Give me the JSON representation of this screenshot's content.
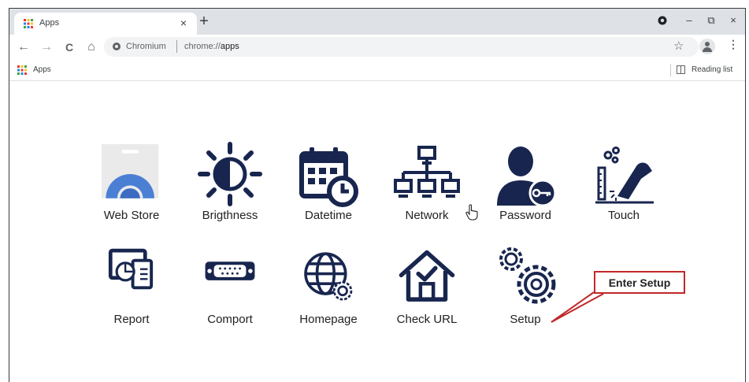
{
  "browser": {
    "tab": {
      "title": "Apps",
      "close_glyph": "×"
    },
    "new_tab_glyph": "+",
    "window_controls": {
      "minimize": "–",
      "restore": "⧉",
      "close": "×"
    },
    "nav": {
      "back": "←",
      "forward": "→",
      "reload": "C",
      "home": "⌂"
    },
    "omnibox": {
      "origin_label": "Chromium",
      "url_scheme": "chrome://",
      "url_host": "apps"
    },
    "star_glyph": "☆",
    "menu_glyph": "⋮",
    "bookmarks": {
      "apps_label": "Apps",
      "reading_list_label": "Reading list"
    }
  },
  "apps": [
    {
      "label": "Web Store",
      "icon": "web-store-icon"
    },
    {
      "label": "Brigthness",
      "icon": "brightness-icon"
    },
    {
      "label": "Datetime",
      "icon": "calendar-clock-icon"
    },
    {
      "label": "Network",
      "icon": "network-icon"
    },
    {
      "label": "Password",
      "icon": "user-key-icon"
    },
    {
      "label": "Touch",
      "icon": "touch-calibration-icon"
    },
    {
      "label": "Report",
      "icon": "report-icon"
    },
    {
      "label": "Comport",
      "icon": "serial-port-icon"
    },
    {
      "label": "Homepage",
      "icon": "globe-gear-icon"
    },
    {
      "label": "Check URL",
      "icon": "home-check-icon"
    },
    {
      "label": "Setup",
      "icon": "gears-icon"
    }
  ],
  "callout": {
    "text": "Enter Setup",
    "border_color": "#c0282a"
  },
  "colors": {
    "icon_navy": "#18264f",
    "webstore_blue": "#4a7fd4"
  }
}
